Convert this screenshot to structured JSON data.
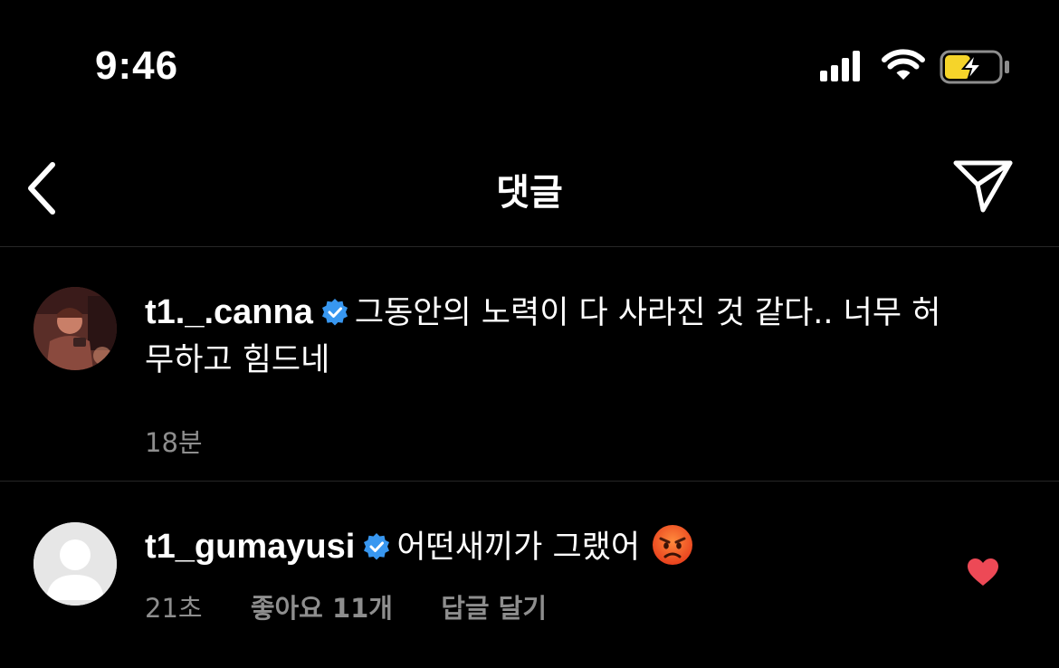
{
  "status_bar": {
    "time": "9:46",
    "battery_color": "#f5d42a"
  },
  "header": {
    "title": "댓글",
    "back_icon": "chevron-left-icon",
    "share_icon": "paper-plane-icon"
  },
  "comments": [
    {
      "username": "t1._.canna",
      "verified": true,
      "text": "그동안의 노력이 다 사라진 것 같다.. 너무 허무하고 힘드네",
      "time": "18분"
    },
    {
      "username": "t1_gumayusi",
      "verified": true,
      "text": "어떤새끼가 그랬어",
      "emoji": "angry-face-emoji",
      "time": "21초",
      "likes": "좋아요 11개",
      "reply_label": "답글 달기",
      "liked": true
    }
  ],
  "colors": {
    "background": "#000000",
    "verified_blue": "#3897f0",
    "heart_red": "#ed4956",
    "meta_gray": "#8e8e8e"
  }
}
